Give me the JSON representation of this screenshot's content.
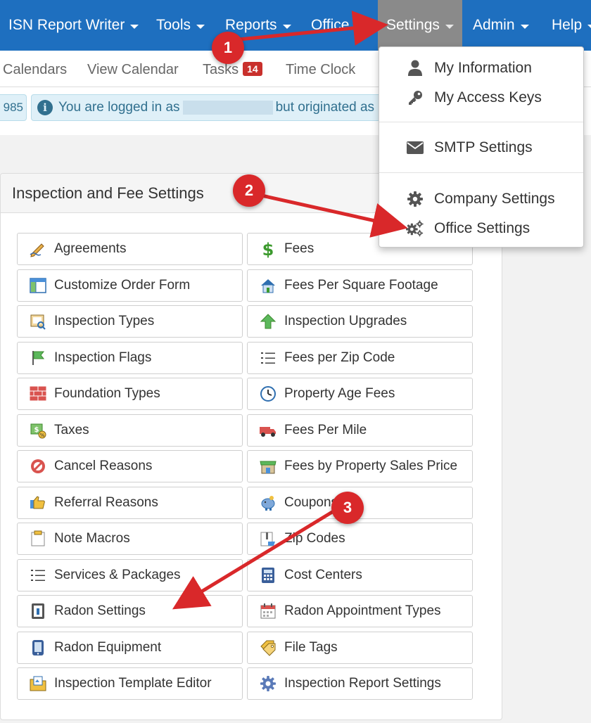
{
  "topnav": {
    "items": [
      {
        "label": "ISN Report Writer"
      },
      {
        "label": "Tools"
      },
      {
        "label": "Reports"
      },
      {
        "label": "Office"
      },
      {
        "label": "Settings"
      },
      {
        "label": "Admin"
      },
      {
        "label": "Help"
      }
    ]
  },
  "subnav": {
    "items": [
      {
        "label": "Calendars"
      },
      {
        "label": "View Calendar"
      },
      {
        "label": "Tasks",
        "badge": "14"
      },
      {
        "label": "Time Clock"
      }
    ]
  },
  "info": {
    "left_fragment": "985",
    "text_before": "You are logged in as",
    "text_after": "but originated as"
  },
  "panel": {
    "title": "Inspection and Fee Settings",
    "buttons": [
      {
        "label": "Agreements",
        "icon": "pen-signature-icon"
      },
      {
        "label": "Fees",
        "icon": "dollar-icon"
      },
      {
        "label": "Customize Order Form",
        "icon": "form-table-icon"
      },
      {
        "label": "Fees Per Square Footage",
        "icon": "house-icon"
      },
      {
        "label": "Inspection Types",
        "icon": "inspection-types-icon"
      },
      {
        "label": "Inspection Upgrades",
        "icon": "up-arrow-icon"
      },
      {
        "label": "Inspection Flags",
        "icon": "flag-icon"
      },
      {
        "label": "Fees per Zip Code",
        "icon": "list-icon"
      },
      {
        "label": "Foundation Types",
        "icon": "bricks-icon"
      },
      {
        "label": "Property Age Fees",
        "icon": "clock-icon"
      },
      {
        "label": "Taxes",
        "icon": "tax-icon"
      },
      {
        "label": "Fees Per Mile",
        "icon": "truck-icon"
      },
      {
        "label": "Cancel Reasons",
        "icon": "cancel-icon"
      },
      {
        "label": "Fees by Property Sales Price",
        "icon": "storefront-icon"
      },
      {
        "label": "Referral Reasons",
        "icon": "thumbs-up-icon"
      },
      {
        "label": "Coupons",
        "icon": "piggy-bank-icon"
      },
      {
        "label": "Note Macros",
        "icon": "note-icon"
      },
      {
        "label": "Zip Codes",
        "icon": "zip-folder-icon"
      },
      {
        "label": "Services & Packages",
        "icon": "list-icon"
      },
      {
        "label": "Cost Centers",
        "icon": "calculator-icon"
      },
      {
        "label": "Radon Settings",
        "icon": "radon-device-icon"
      },
      {
        "label": "Radon Appointment Types",
        "icon": "calendar-icon"
      },
      {
        "label": "Radon Equipment",
        "icon": "phone-device-icon"
      },
      {
        "label": "File Tags",
        "icon": "tags-icon"
      },
      {
        "label": "Inspection Template Editor",
        "icon": "template-folder-icon"
      },
      {
        "label": "Inspection Report Settings",
        "icon": "gear-badge-icon"
      }
    ]
  },
  "dropdown": {
    "items": [
      {
        "label": "My Information",
        "icon": "user-icon"
      },
      {
        "label": "My Access Keys",
        "icon": "key-icon"
      },
      {
        "label": "SMTP Settings",
        "icon": "envelope-icon"
      },
      {
        "label": "Company Settings",
        "icon": "gear-icon"
      },
      {
        "label": "Office Settings",
        "icon": "gears-icon"
      }
    ]
  },
  "annotations": {
    "steps": [
      "1",
      "2",
      "3"
    ],
    "color": "#d9282a"
  },
  "colors": {
    "nav": "#1e6fbf",
    "nav_active": "#8a8a8a",
    "info_bg": "#dff0f8",
    "badge": "#c9302c"
  }
}
